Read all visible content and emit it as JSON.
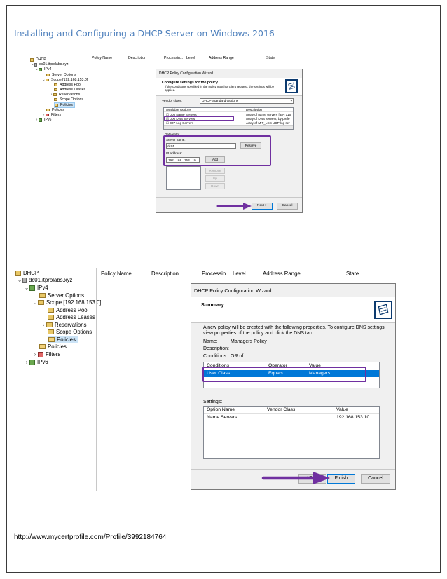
{
  "page": {
    "heading": "Installing and Configuring a DHCP Server on Windows 2016",
    "footer_url": "http://www.mycertprofile.com/Profile/3992184764"
  },
  "tree": {
    "root": "DHCP",
    "server": "dc01.itprolabs.xyz",
    "ipv4": "IPv4",
    "server_options": "Server Options",
    "scope": "Scope [192.168.153.0]",
    "address_pool": "Address Pool",
    "address_leases": "Address Leases",
    "reservations": "Reservations",
    "scope_options": "Scope Options",
    "policies_scope": "Policies",
    "policies": "Policies",
    "filters": "Filters",
    "ipv6": "IPv6"
  },
  "columns": {
    "policy_name": "Policy Name",
    "description": "Description",
    "processing": "Processin...",
    "level": "Level",
    "address_range": "Address Range",
    "state": "State"
  },
  "wizard1": {
    "title": "DHCP Policy Configuration Wizard",
    "heading": "Configure settings for the policy",
    "subheading": "If the conditions specified in the policy match a client request, the settings will be applied.",
    "vendor_class_label": "Vendor class:",
    "vendor_class_value": "DHCP Standard Options",
    "options_header_available": "Available Options",
    "options_header_description": "Description",
    "options": [
      {
        "name": "005 Name Servers",
        "desc": "Array of name servers [IEN 116",
        "checked": false
      },
      {
        "name": "006 DNS Servers",
        "desc": "Array of DNS servers, by prefe",
        "checked": true
      },
      {
        "name": "007 Log Servers",
        "desc": "Array of MIT_LCS UDP log ser",
        "checked": false
      }
    ],
    "data_entry_label": "Data entry",
    "server_name_label": "Server name:",
    "server_name_value": "dc01",
    "resolve_label": "Resolve",
    "ip_label": "IP address:",
    "ip_value": "192 . 168 . 153 . 10",
    "add_label": "Add",
    "remove_label": "Remove",
    "up_label": "Up",
    "down_label": "Down",
    "next_label": "Next >",
    "cancel_label": "Cancel"
  },
  "wizard2": {
    "title": "DHCP Policy Configuration Wizard",
    "heading": "Summary",
    "intro": "A new policy will be created with the following properties. To configure DNS settings, view properties of the policy and click the DNS tab.",
    "name_label": "Name:",
    "name_value": "Managers Policy",
    "description_label": "Description:",
    "conditions_label": "Conditions:",
    "conditions_value": "OR of",
    "cond_headers": {
      "conditions": "Conditions",
      "operator": "Operator",
      "value": "Value"
    },
    "cond_row": {
      "conditions": "User Class",
      "operator": "Equals",
      "value": "Managers"
    },
    "settings_label": "Settings:",
    "settings_headers": {
      "option_name": "Option Name",
      "vendor_class": "Vendor Class",
      "value": "Value"
    },
    "settings_row": {
      "option_name": "Name Servers",
      "vendor_class": "",
      "value": "192.168.153.10"
    },
    "back_label": "< Back",
    "finish_label": "Finish",
    "cancel_label": "Cancel"
  },
  "colors": {
    "heading": "#4f81bd",
    "highlight": "#7030a0",
    "selection": "#0078d7"
  }
}
